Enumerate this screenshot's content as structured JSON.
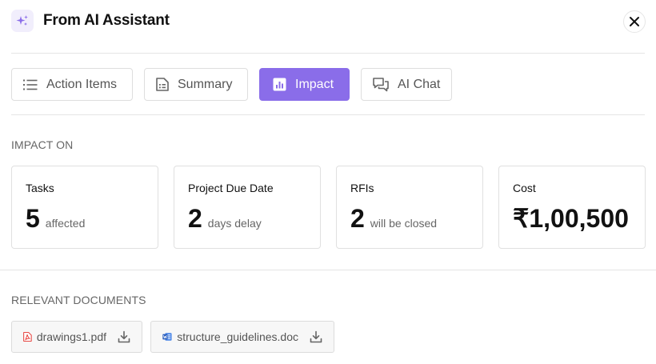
{
  "header": {
    "title": "From AI Assistant",
    "icon": "sparkles-icon",
    "close_icon": "close-icon"
  },
  "tabs": [
    {
      "label": "Action Items",
      "icon": "list-icon",
      "active": false
    },
    {
      "label": "Summary",
      "icon": "document-icon",
      "active": false
    },
    {
      "label": "Impact",
      "icon": "bar-chart-icon",
      "active": true
    },
    {
      "label": "AI Chat",
      "icon": "chat-icon",
      "active": false
    }
  ],
  "impact": {
    "section_label": "IMPACT ON",
    "cards": [
      {
        "title": "Tasks",
        "value": "5",
        "unit": "affected"
      },
      {
        "title": "Project Due Date",
        "value": "2",
        "unit": "days delay"
      },
      {
        "title": "RFIs",
        "value": "2",
        "unit": "will be closed"
      },
      {
        "title": "Cost",
        "value": "₹1,00,500",
        "unit": ""
      }
    ]
  },
  "documents": {
    "section_label": "RELEVANT DOCUMENTS",
    "items": [
      {
        "name": "drawings1.pdf",
        "icon": "pdf-icon",
        "action_icon": "download-icon"
      },
      {
        "name": "structure_guidelines.doc",
        "icon": "word-doc-icon",
        "action_icon": "download-icon"
      }
    ]
  },
  "colors": {
    "accent": "#8a6de9",
    "accent_soft": "#f1eefc",
    "pdf_red": "#e5322d",
    "word_blue": "#2b5fbf"
  }
}
